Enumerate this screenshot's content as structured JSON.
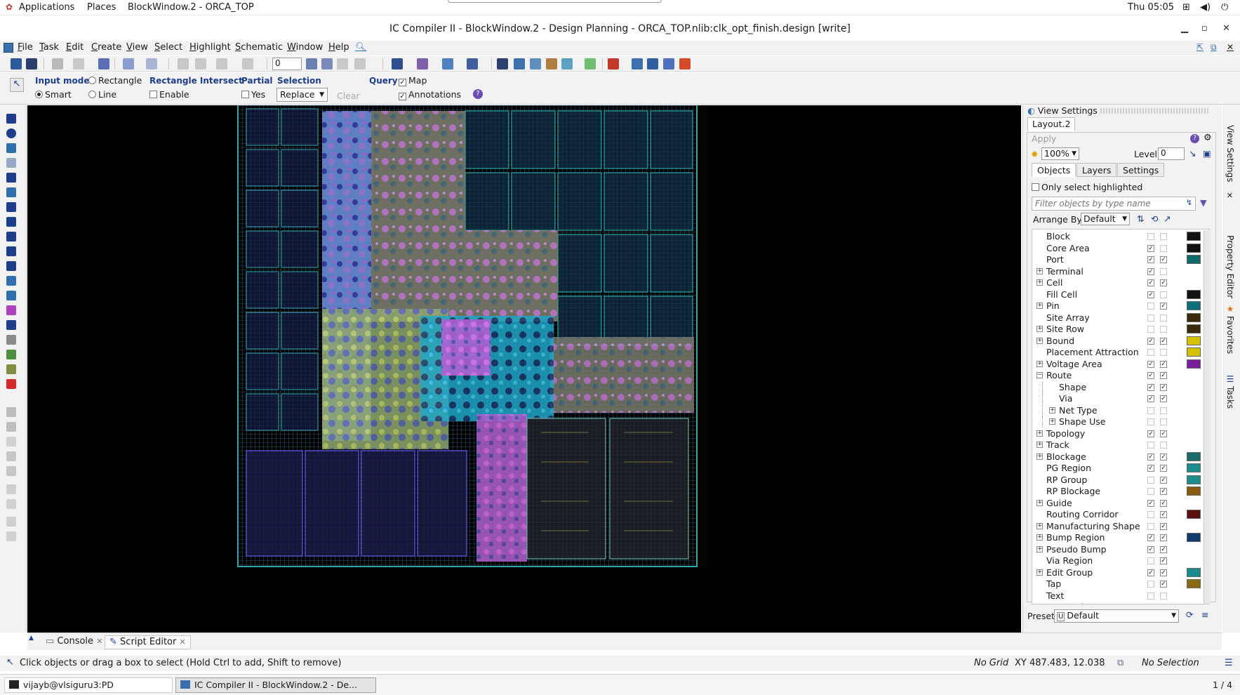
{
  "topbar": {
    "applications": "Applications",
    "places": "Places",
    "active_window": "BlockWindow.2 - ORCA_TOP",
    "clock": "Thu 05:05"
  },
  "window": {
    "title": "IC Compiler II - BlockWindow.2 - Design Planning - ORCA_TOP.nlib:clk_opt_finish.design [write]"
  },
  "menu": [
    "File",
    "Task",
    "Edit",
    "Create",
    "View",
    "Select",
    "Highlight",
    "Schematic",
    "Window",
    "Help"
  ],
  "toolbar": {
    "zoom_value": "0"
  },
  "options": {
    "input_mode_label": "Input mode",
    "rectangle": "Rectangle",
    "smart": "Smart",
    "line": "Line",
    "rect_intersect_label": "Rectangle Intersect",
    "enable": "Enable",
    "partial_label": "Partial",
    "yes": "Yes",
    "selection_label": "Selection",
    "selection_value": "Replace",
    "clear": "Clear",
    "query_label": "Query",
    "map": "Map",
    "annotations": "Annotations"
  },
  "panel": {
    "header": "View Settings",
    "layout_tab": "Layout.2",
    "apply": "Apply",
    "zoom": "100%",
    "level_label": "Level",
    "level_value": "0",
    "tabs": [
      "Objects",
      "Layers",
      "Settings"
    ],
    "only_select_highlighted": "Only select highlighted",
    "filter_placeholder": "Filter objects by type name",
    "arrange_by_label": "Arrange By",
    "arrange_by_value": "Default",
    "preset_label": "Preset",
    "preset_value": "Default",
    "objects": [
      {
        "label": "Block",
        "indent": 0,
        "expander": "",
        "c1": "",
        "c2": "",
        "swatch": "#111111"
      },
      {
        "label": "Core Area",
        "indent": 0,
        "expander": "",
        "c1": "✓",
        "c2": "",
        "swatch": "#111111"
      },
      {
        "label": "Port",
        "indent": 0,
        "expander": "",
        "c1": "✓",
        "c2": "✓",
        "swatch": "#0f6b6b"
      },
      {
        "label": "Terminal",
        "indent": 0,
        "expander": "+",
        "c1": "✓",
        "c2": "",
        "swatch": ""
      },
      {
        "label": "Cell",
        "indent": 0,
        "expander": "+",
        "c1": "✓",
        "c2": "✓",
        "swatch": ""
      },
      {
        "label": "Fill Cell",
        "indent": 0,
        "expander": "",
        "c1": "✓",
        "c2": "",
        "swatch": "#111111"
      },
      {
        "label": "Pin",
        "indent": 0,
        "expander": "+",
        "c1": "",
        "c2": "✓",
        "swatch": "#0e6f7a"
      },
      {
        "label": "Site Array",
        "indent": 0,
        "expander": "",
        "c1": "",
        "c2": "",
        "swatch": "#3a2a0a"
      },
      {
        "label": "Site Row",
        "indent": 0,
        "expander": "+",
        "c1": "",
        "c2": "",
        "swatch": "#3a2a0a"
      },
      {
        "label": "Bound",
        "indent": 0,
        "expander": "+",
        "c1": "✓",
        "c2": "✓",
        "swatch": "#d4c200"
      },
      {
        "label": "Placement Attraction",
        "indent": 0,
        "expander": "",
        "c1": "",
        "c2": "",
        "swatch": "#d4c200"
      },
      {
        "label": "Voltage Area",
        "indent": 0,
        "expander": "+",
        "c1": "✓",
        "c2": "✓",
        "swatch": "#7a1f9c"
      },
      {
        "label": "Route",
        "indent": 0,
        "expander": "−",
        "c1": "✓",
        "c2": "✓",
        "swatch": ""
      },
      {
        "label": "Shape",
        "indent": 1,
        "expander": "",
        "c1": "✓",
        "c2": "✓",
        "swatch": ""
      },
      {
        "label": "Via",
        "indent": 1,
        "expander": "",
        "c1": "✓",
        "c2": "✓",
        "swatch": ""
      },
      {
        "label": "Net Type",
        "indent": 1,
        "expander": "+",
        "c1": "",
        "c2": "",
        "swatch": ""
      },
      {
        "label": "Shape Use",
        "indent": 1,
        "expander": "+",
        "c1": "",
        "c2": "",
        "swatch": ""
      },
      {
        "label": "Topology",
        "indent": 0,
        "expander": "+",
        "c1": "✓",
        "c2": "✓",
        "swatch": ""
      },
      {
        "label": "Track",
        "indent": 0,
        "expander": "+",
        "c1": "",
        "c2": "",
        "swatch": ""
      },
      {
        "label": "Blockage",
        "indent": 0,
        "expander": "+",
        "c1": "✓",
        "c2": "✓",
        "swatch": "#1b6b6b"
      },
      {
        "label": "PG Region",
        "indent": 0,
        "expander": "",
        "c1": "✓",
        "c2": "✓",
        "swatch": "#1b8b8b"
      },
      {
        "label": "RP Group",
        "indent": 0,
        "expander": "",
        "c1": "",
        "c2": "✓",
        "swatch": "#1b8b8b"
      },
      {
        "label": "RP Blockage",
        "indent": 0,
        "expander": "",
        "c1": "",
        "c2": "✓",
        "swatch": "#8a5a10"
      },
      {
        "label": "Guide",
        "indent": 0,
        "expander": "+",
        "c1": "✓",
        "c2": "✓",
        "swatch": ""
      },
      {
        "label": "Routing Corridor",
        "indent": 0,
        "expander": "",
        "c1": "",
        "c2": "✓",
        "swatch": "#5a1010"
      },
      {
        "label": "Manufacturing Shape",
        "indent": 0,
        "expander": "+",
        "c1": "",
        "c2": "✓",
        "swatch": ""
      },
      {
        "label": "Bump Region",
        "indent": 0,
        "expander": "+",
        "c1": "✓",
        "c2": "✓",
        "swatch": "#103a6b"
      },
      {
        "label": "Pseudo Bump",
        "indent": 0,
        "expander": "+",
        "c1": "✓",
        "c2": "✓",
        "swatch": ""
      },
      {
        "label": "Via Region",
        "indent": 0,
        "expander": "",
        "c1": "",
        "c2": "✓",
        "swatch": ""
      },
      {
        "label": "Edit Group",
        "indent": 0,
        "expander": "+",
        "c1": "✓",
        "c2": "✓",
        "swatch": "#1b8b8b"
      },
      {
        "label": "Tap",
        "indent": 0,
        "expander": "",
        "c1": "",
        "c2": "✓",
        "swatch": "#8a6a10"
      },
      {
        "label": "Text",
        "indent": 0,
        "expander": "",
        "c1": "",
        "c2": "",
        "swatch": ""
      },
      {
        "label": "Annotation",
        "indent": 0,
        "expander": "",
        "c1": "✓",
        "c2": "✓",
        "swatch": ""
      }
    ]
  },
  "right_vtabs": [
    "View Settings",
    "Property Editor",
    "Favorites",
    "Tasks"
  ],
  "console": {
    "tab1": "Console",
    "tab2": "Script Editor"
  },
  "status": {
    "message": "Click objects or drag a box to select (Hold Ctrl to add, Shift to remove)",
    "grid": "No Grid",
    "coords": "XY 487.483, 12.038",
    "selection": "No Selection"
  },
  "taskbar": {
    "terminal": "vijayb@vlsiguru3:PD",
    "app": "IC Compiler II - BlockWindow.2 - De...",
    "workspace": "1 / 4"
  },
  "colors": {
    "accent_label": "#1d3e8f",
    "canvas_bg": "#000000"
  }
}
